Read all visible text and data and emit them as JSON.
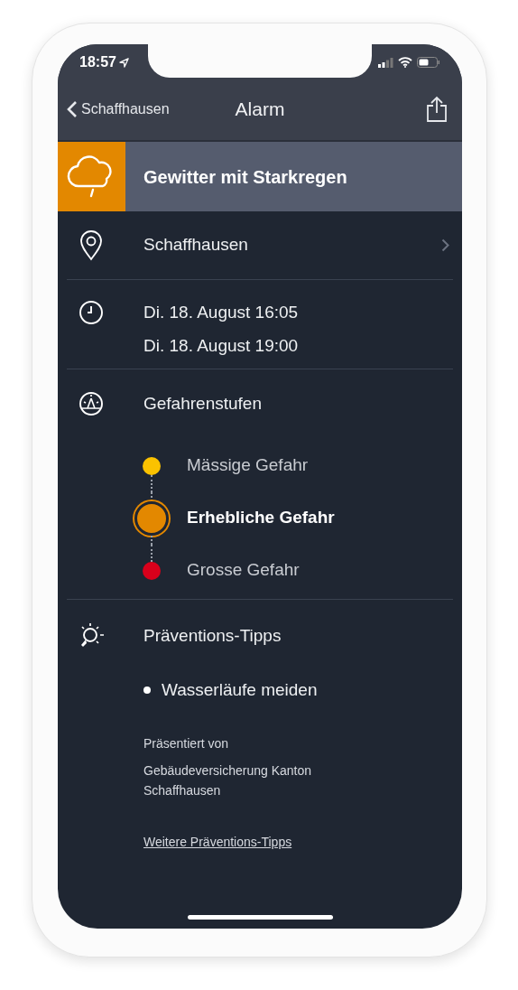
{
  "status_bar": {
    "time": "18:57"
  },
  "nav": {
    "back_label": "Schaffhausen",
    "title": "Alarm"
  },
  "alert": {
    "title": "Gewitter mit Starkregen",
    "color": "#e38800"
  },
  "location": {
    "label": "Schaffhausen"
  },
  "period": {
    "start": "Di. 18. August 16:05",
    "end": "Di. 18. August 19:00"
  },
  "hazard_levels": {
    "title": "Gefahrenstufen",
    "levels": [
      {
        "label": "Mässige Gefahr",
        "color": "#fbc200",
        "selected": false
      },
      {
        "label": "Erhebliche Gefahr",
        "color": "#e38800",
        "selected": true
      },
      {
        "label": "Grosse Gefahr",
        "color": "#d9001b",
        "selected": false
      }
    ]
  },
  "prevention": {
    "title": "Präventions-Tipps",
    "tips": [
      "Wasserläufe meiden"
    ],
    "presented_by": "Präsentiert von",
    "sponsor": "Gebäudeversicherung Kanton Schaffhausen",
    "link": "Weitere Präventions-Tipps"
  }
}
